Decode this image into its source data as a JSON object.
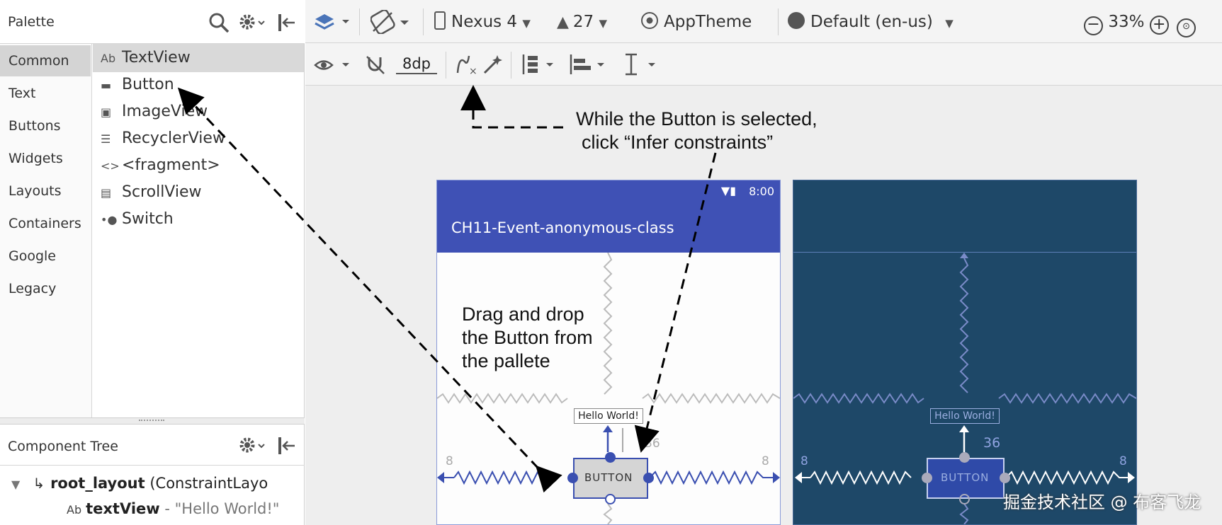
{
  "palette": {
    "title": "Palette",
    "categories": [
      "Common",
      "Text",
      "Buttons",
      "Widgets",
      "Layouts",
      "Containers",
      "Google",
      "Legacy"
    ],
    "selected_category": "Common",
    "components": [
      {
        "icon": "Ab",
        "label": "TextView"
      },
      {
        "icon": "▬",
        "label": "Button"
      },
      {
        "icon": "▣",
        "label": "ImageView"
      },
      {
        "icon": "☰",
        "label": "RecyclerView"
      },
      {
        "icon": "<>",
        "label": "<fragment>"
      },
      {
        "icon": "▤",
        "label": "ScrollView"
      },
      {
        "icon": "•●",
        "label": "Switch"
      }
    ]
  },
  "component_tree": {
    "title": "Component Tree",
    "root_name": "root_layout",
    "root_type": "(ConstraintLayo",
    "child_icon": "Ab",
    "child_name": "textView",
    "child_text": "- \"Hello World!\""
  },
  "toolbar1": {
    "device": "Nexus 4",
    "api": "27",
    "theme": "AppTheme",
    "locale": "Default (en-us)",
    "zoom": "33%"
  },
  "toolbar2": {
    "margin": "8dp"
  },
  "phone": {
    "status_time": "8:00",
    "app_title": "CH11-Event-anonymous-class",
    "hello_text": "Hello World!",
    "button_text": "BUTTON",
    "margin_left": "8",
    "margin_right": "8",
    "margin_top": "36"
  },
  "annotations": {
    "infer_line1": "While the Button is selected,",
    "infer_line2": "click “Infer constraints”",
    "drag_line1": "Drag and drop",
    "drag_line2": "the Button from",
    "drag_line3": "the pallete"
  },
  "watermark": "掘金技术社区 @ 布客飞龙",
  "colors": {
    "appbar": "#3f51b5",
    "blueprint": "#1e4868",
    "constraint": "#3a4fb0"
  }
}
